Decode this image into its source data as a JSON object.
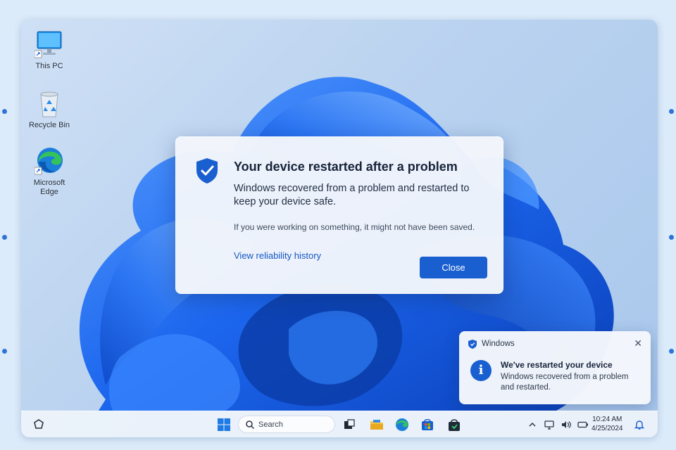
{
  "desktop": {
    "icons": [
      {
        "label": "This PC",
        "icon": "computer-icon"
      },
      {
        "label": "Recycle Bin",
        "icon": "recycle-bin-icon"
      },
      {
        "label": "Microsoft\nEdge",
        "icon": "edge-icon"
      }
    ]
  },
  "dialog": {
    "title": "Your device restarted after a problem",
    "body": "Windows recovered from a problem and restarted to keep your device safe.",
    "note": "If you were working on something, it might not have been saved.",
    "link": "View reliability history",
    "close_label": "Close",
    "icon": "shield-check-icon"
  },
  "toast": {
    "app_name": "Windows",
    "title": "We've restarted your device",
    "body": "Windows recovered from a problem and restarted.",
    "icon": "info-icon"
  },
  "taskbar": {
    "search_placeholder": "Search",
    "apps": [
      "start-icon",
      "task-view-icon",
      "file-explorer-icon",
      "edge-icon",
      "store-icon",
      "shopping-bag-icon"
    ],
    "time": "10:24 AM",
    "date": "4/25/2024"
  },
  "colors": {
    "accent": "#1a5fd0",
    "wallpaper_blue": "#1f6ef0"
  }
}
